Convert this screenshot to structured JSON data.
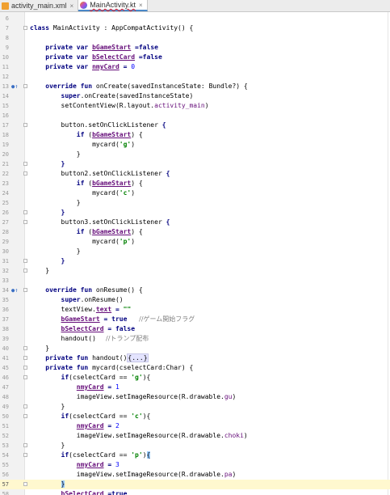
{
  "tabs": [
    {
      "label": "activity_main.xml",
      "icon": "xml-file-icon",
      "active": false
    },
    {
      "label": "MainActivity.kt",
      "icon": "kotlin-file-icon",
      "active": true
    }
  ],
  "tab_close_glyph": "×",
  "lines": [
    {
      "n": "6",
      "tokens": []
    },
    {
      "n": "7",
      "tokens": [
        [
          "kw",
          "class "
        ],
        [
          "",
          "MainActivity : AppCompatActivity() {"
        ]
      ]
    },
    {
      "n": "8",
      "tokens": []
    },
    {
      "n": "9",
      "tokens": [
        [
          "",
          "    "
        ],
        [
          "kw",
          "private var "
        ],
        [
          "propu",
          "bGameStart"
        ],
        [
          "kw",
          " =false"
        ]
      ]
    },
    {
      "n": "10",
      "tokens": [
        [
          "",
          "    "
        ],
        [
          "kw",
          "private var "
        ],
        [
          "propu",
          "bSelectCard"
        ],
        [
          "kw",
          " =false"
        ]
      ]
    },
    {
      "n": "11",
      "tokens": [
        [
          "",
          "    "
        ],
        [
          "kw",
          "private var "
        ],
        [
          "propu",
          "nmyCard"
        ],
        [
          "kw",
          " = "
        ],
        [
          "num",
          "0"
        ]
      ]
    },
    {
      "n": "12",
      "tokens": []
    },
    {
      "n": "13",
      "mark": "●↑",
      "tokens": [
        [
          "",
          "    "
        ],
        [
          "kw",
          "override fun "
        ],
        [
          "",
          "onCreate(savedInstanceState: Bundle?) {"
        ]
      ]
    },
    {
      "n": "14",
      "tokens": [
        [
          "",
          "        "
        ],
        [
          "kw",
          "super"
        ],
        [
          "",
          ".onCreate(savedInstanceState)"
        ]
      ]
    },
    {
      "n": "15",
      "tokens": [
        [
          "",
          "        setContentView(R.layout."
        ],
        [
          "fld",
          "activity_main"
        ],
        [
          "",
          ")"
        ]
      ]
    },
    {
      "n": "16",
      "tokens": []
    },
    {
      "n": "17",
      "tokens": [
        [
          "",
          "        button.setOnClickListener "
        ],
        [
          "kw",
          "{"
        ]
      ]
    },
    {
      "n": "18",
      "tokens": [
        [
          "",
          "            "
        ],
        [
          "kw",
          "if "
        ],
        [
          "",
          "("
        ],
        [
          "propu",
          "bGameStart"
        ],
        [
          "",
          ") {"
        ]
      ]
    },
    {
      "n": "19",
      "tokens": [
        [
          "",
          "                mycard("
        ],
        [
          "str",
          "'g'"
        ],
        [
          "",
          ")"
        ]
      ]
    },
    {
      "n": "20",
      "tokens": [
        [
          "",
          "            }"
        ]
      ]
    },
    {
      "n": "21",
      "tokens": [
        [
          "",
          "        "
        ],
        [
          "kw",
          "}"
        ]
      ]
    },
    {
      "n": "22",
      "tokens": [
        [
          "",
          "        button2.setOnClickListener "
        ],
        [
          "kw",
          "{"
        ]
      ]
    },
    {
      "n": "23",
      "tokens": [
        [
          "",
          "            "
        ],
        [
          "kw",
          "if "
        ],
        [
          "",
          "("
        ],
        [
          "propu",
          "bGameStart"
        ],
        [
          "",
          ") {"
        ]
      ]
    },
    {
      "n": "24",
      "tokens": [
        [
          "",
          "                mycard("
        ],
        [
          "str",
          "'c'"
        ],
        [
          "",
          ")"
        ]
      ]
    },
    {
      "n": "25",
      "tokens": [
        [
          "",
          "            }"
        ]
      ]
    },
    {
      "n": "26",
      "tokens": [
        [
          "",
          "        "
        ],
        [
          "kw",
          "}"
        ]
      ]
    },
    {
      "n": "27",
      "tokens": [
        [
          "",
          "        button3.setOnClickListener "
        ],
        [
          "kw",
          "{"
        ]
      ]
    },
    {
      "n": "28",
      "tokens": [
        [
          "",
          "            "
        ],
        [
          "kw",
          "if "
        ],
        [
          "",
          "("
        ],
        [
          "propu",
          "bGameStart"
        ],
        [
          "",
          ") {"
        ]
      ]
    },
    {
      "n": "29",
      "tokens": [
        [
          "",
          "                mycard("
        ],
        [
          "str",
          "'p'"
        ],
        [
          "",
          ")"
        ]
      ]
    },
    {
      "n": "30",
      "tokens": [
        [
          "",
          "            }"
        ]
      ]
    },
    {
      "n": "31",
      "tokens": [
        [
          "",
          "        "
        ],
        [
          "kw",
          "}"
        ]
      ]
    },
    {
      "n": "32",
      "tokens": [
        [
          "",
          "    }"
        ]
      ]
    },
    {
      "n": "33",
      "tokens": []
    },
    {
      "n": "34",
      "mark": "●↑",
      "tokens": [
        [
          "",
          "    "
        ],
        [
          "kw",
          "override fun "
        ],
        [
          "",
          "onResume() {"
        ]
      ]
    },
    {
      "n": "35",
      "tokens": [
        [
          "",
          "        "
        ],
        [
          "kw",
          "super"
        ],
        [
          "",
          ".onResume()"
        ]
      ]
    },
    {
      "n": "36",
      "tokens": [
        [
          "",
          "        textView."
        ],
        [
          "propu",
          "text"
        ],
        [
          "",
          ""
        ],
        [
          "kw",
          " = "
        ],
        [
          "str",
          "\"\""
        ]
      ]
    },
    {
      "n": "37",
      "tokens": [
        [
          "",
          "        "
        ],
        [
          "propu",
          "bGameStart"
        ],
        [
          "kw",
          " = true  "
        ],
        [
          "cmt",
          "  //ゲーム開始フラグ"
        ]
      ]
    },
    {
      "n": "38",
      "tokens": [
        [
          "",
          "        "
        ],
        [
          "propu",
          "bSelectCard"
        ],
        [
          "kw",
          " = false"
        ]
      ]
    },
    {
      "n": "39",
      "tokens": [
        [
          "",
          "        handout()  "
        ],
        [
          "cmt",
          " //トランプ配布"
        ]
      ]
    },
    {
      "n": "40",
      "tokens": [
        [
          "",
          "    }"
        ]
      ]
    },
    {
      "n": "41",
      "tokens": [
        [
          "",
          "    "
        ],
        [
          "kw",
          "private fun "
        ],
        [
          "",
          "handout()"
        ],
        [
          "fb",
          "{...}"
        ]
      ]
    },
    {
      "n": "45",
      "tokens": [
        [
          "",
          "    "
        ],
        [
          "kw",
          "private fun "
        ],
        [
          "",
          "mycard(cselectCard:Char) {"
        ]
      ]
    },
    {
      "n": "46",
      "tokens": [
        [
          "",
          "        "
        ],
        [
          "kw",
          "if"
        ],
        [
          "",
          "(cselectCard == "
        ],
        [
          "str",
          "'g'"
        ],
        [
          "",
          ""
        ],
        [
          "kw",
          ""
        ],
        [
          "",
          "){"
        ]
      ]
    },
    {
      "n": "47",
      "tokens": [
        [
          "",
          "            "
        ],
        [
          "propu",
          "nmyCard"
        ],
        [
          "kw",
          " = "
        ],
        [
          "num",
          "1"
        ]
      ]
    },
    {
      "n": "48",
      "tokens": [
        [
          "",
          "            imageView.setImageResource(R.drawable."
        ],
        [
          "fld",
          "gu"
        ],
        [
          "",
          ")"
        ]
      ]
    },
    {
      "n": "49",
      "tokens": [
        [
          "",
          "        }"
        ]
      ]
    },
    {
      "n": "50",
      "tokens": [
        [
          "",
          "        "
        ],
        [
          "kw",
          "if"
        ],
        [
          "",
          "(cselectCard == "
        ],
        [
          "str",
          "'c'"
        ],
        [
          "",
          "){"
        ]
      ]
    },
    {
      "n": "51",
      "tokens": [
        [
          "",
          "            "
        ],
        [
          "propu",
          "nmyCard"
        ],
        [
          "kw",
          " = "
        ],
        [
          "num",
          "2"
        ]
      ]
    },
    {
      "n": "52",
      "tokens": [
        [
          "",
          "            imageView.setImageResource(R.drawable."
        ],
        [
          "fld",
          "choki"
        ],
        [
          "",
          ")"
        ]
      ]
    },
    {
      "n": "53",
      "tokens": [
        [
          "",
          "        }"
        ]
      ]
    },
    {
      "n": "54",
      "tokens": [
        [
          "",
          "        "
        ],
        [
          "kw",
          "if"
        ],
        [
          "",
          "(cselectCard == "
        ],
        [
          "str",
          "'p'"
        ],
        [
          "",
          ")"
        ],
        [
          "hb",
          "{"
        ]
      ]
    },
    {
      "n": "55",
      "tokens": [
        [
          "",
          "            "
        ],
        [
          "propu",
          "nmyCard"
        ],
        [
          "kw",
          " = "
        ],
        [
          "num",
          "3"
        ]
      ]
    },
    {
      "n": "56",
      "tokens": [
        [
          "",
          "            imageView.setImageResource(R.drawable."
        ],
        [
          "fld",
          "pa"
        ],
        [
          "",
          ")"
        ]
      ]
    },
    {
      "n": "57",
      "current": true,
      "tokens": [
        [
          "",
          "        "
        ],
        [
          "hb",
          "}"
        ]
      ]
    },
    {
      "n": "58",
      "tokens": [
        [
          "",
          "        "
        ],
        [
          "propu",
          "bSelectCard"
        ],
        [
          "kw",
          " =true"
        ]
      ]
    }
  ]
}
